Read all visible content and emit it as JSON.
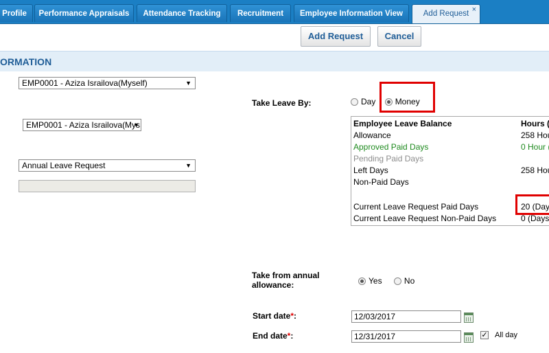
{
  "tabs": [
    {
      "label": "Profile"
    },
    {
      "label": "Performance Appraisals"
    },
    {
      "label": "Attendance Tracking"
    },
    {
      "label": "Recruitment"
    },
    {
      "label": "Employee Information View"
    },
    {
      "label": "Add Request",
      "close": "×"
    }
  ],
  "toolbar": {
    "add_request_label": "Add Request",
    "cancel_label": "Cancel"
  },
  "section": {
    "title": "ORMATION"
  },
  "form": {
    "employee_select": "EMP0001 - Aziza Israilova(Myself)",
    "employee_select_2": "EMP0001 - Aziza Israilova(Mys",
    "leave_type_select": "Annual Leave Request",
    "take_leave_by_label": "Take Leave By:",
    "take_leave_by_options": [
      "Day",
      "Money"
    ],
    "take_leave_by_selected": "Money",
    "take_from_annual_label_1": "Take from annual",
    "take_from_annual_label_2": "allowance:",
    "take_from_annual_options": [
      "Yes",
      "No"
    ],
    "take_from_annual_selected": "Yes",
    "start_date_label": "Start date",
    "start_date_value": "12/03/2017",
    "end_date_label": "End date",
    "end_date_value": "12/31/2017",
    "required_mark": "*",
    "colon": ":",
    "all_day_label": "All day",
    "all_day_checked": true
  },
  "balance": {
    "header": "Employee Leave Balance",
    "header_value": "Hours (",
    "rows": [
      {
        "label": "Allowance",
        "value": "258 Hou"
      },
      {
        "label": "Approved Paid Days",
        "value": "0 Hour ("
      },
      {
        "label": "Pending Paid Days",
        "value": ""
      },
      {
        "label": "Left Days",
        "value": "258 Hou"
      },
      {
        "label": "Non-Paid Days",
        "value": ""
      },
      {
        "label": "Current Leave Request Paid Days",
        "value": "20 (Day"
      },
      {
        "label": "Current Leave Request Non-Paid Days",
        "value": "0 (Days"
      }
    ]
  },
  "colors": {
    "tab_bar": "#1b7fc4",
    "accent": "#1f5d97",
    "highlight": "#e00000",
    "approved": "#1e8a1e",
    "pending": "#8c8c8c"
  }
}
